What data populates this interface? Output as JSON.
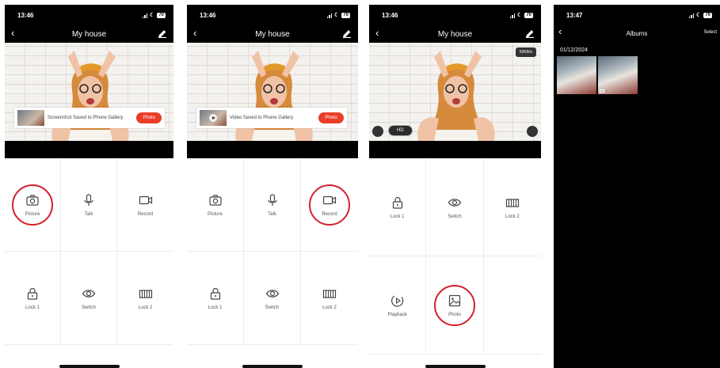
{
  "phones": [
    {
      "status": {
        "time": "13:46",
        "battery": "70"
      },
      "title": "My house",
      "toast": {
        "text": "Screenshot Saved to Phone Gallery",
        "button": "Photo"
      },
      "actions": [
        {
          "label": "Picture",
          "icon": "camera-icon"
        },
        {
          "label": "Talk",
          "icon": "microphone-icon"
        },
        {
          "label": "Record",
          "icon": "video-record-icon"
        },
        {
          "label": "Lock 1",
          "icon": "lock-icon"
        },
        {
          "label": "Switch",
          "icon": "eye-icon"
        },
        {
          "label": "Lock 2",
          "icon": "gate-icon"
        }
      ]
    },
    {
      "status": {
        "time": "13:46",
        "battery": "70"
      },
      "title": "My house",
      "toast": {
        "text": "Video Saved to Phone Gallery",
        "button": "Photo"
      },
      "actions": [
        {
          "label": "Picture",
          "icon": "camera-icon"
        },
        {
          "label": "Talk",
          "icon": "microphone-icon"
        },
        {
          "label": "Record",
          "icon": "video-record-icon"
        },
        {
          "label": "Lock 1",
          "icon": "lock-icon"
        },
        {
          "label": "Switch",
          "icon": "eye-icon"
        },
        {
          "label": "Lock 2",
          "icon": "gate-icon"
        }
      ]
    },
    {
      "status": {
        "time": "13:46",
        "battery": "70"
      },
      "title": "My house",
      "bitrate": "50KB/s",
      "quality": "HD",
      "actions": [
        {
          "label": "Lock 1",
          "icon": "lock-icon"
        },
        {
          "label": "Switch",
          "icon": "eye-icon"
        },
        {
          "label": "Lock 2",
          "icon": "gate-icon"
        },
        {
          "label": "Playback",
          "icon": "playback-icon"
        },
        {
          "label": "Photo",
          "icon": "photo-icon"
        }
      ]
    },
    {
      "status": {
        "time": "13:47",
        "battery": "70"
      },
      "title": "Albums",
      "select": "Select",
      "date": "01/12/2024"
    }
  ],
  "highlight_color": "#d2202c",
  "accent_color": "#ea3d26"
}
